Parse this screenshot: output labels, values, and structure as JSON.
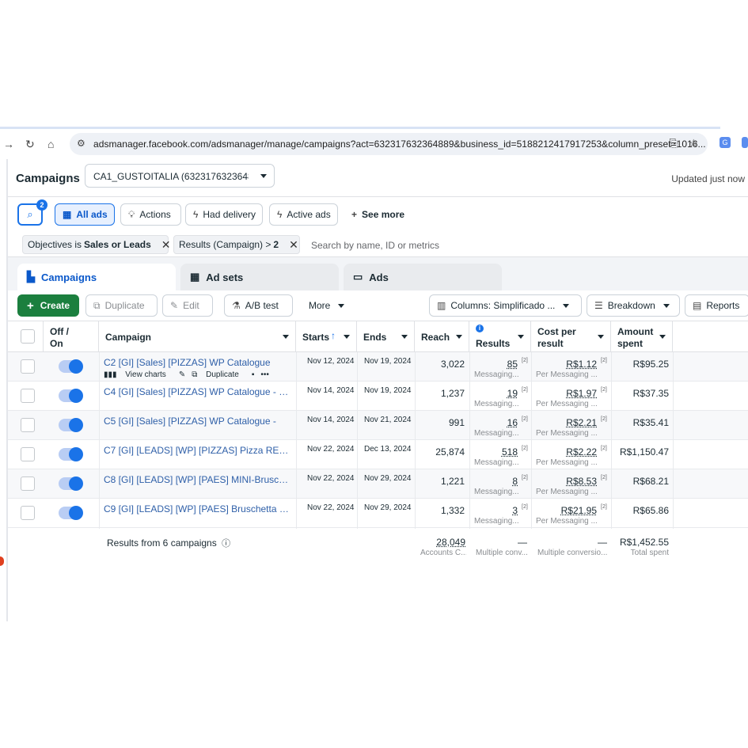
{
  "browser": {
    "url": "adsmanager.facebook.com/adsmanager/manage/campaigns?act=632317632364889&business_id=5188212417917253&column_preset=1016..."
  },
  "header": {
    "title": "Campaigns",
    "account": "CA1_GUSTOITALIA (63231763236488...",
    "updated": "Updated just now"
  },
  "filters": {
    "search_count": "2",
    "buttons": [
      "All ads",
      "Actions",
      "Had delivery",
      "Active ads",
      "See more"
    ],
    "chip1_prefix": "Objectives is",
    "chip1_value": "Sales or Leads",
    "chip2_prefix": "Results (Campaign) >",
    "chip2_value": "2",
    "search_placeholder": "Search by name, ID or metrics"
  },
  "tabs": [
    "Campaigns",
    "Ad sets",
    "Ads"
  ],
  "toolbar": {
    "create": "Create",
    "duplicate": "Duplicate",
    "edit": "Edit",
    "ab_test": "A/B test",
    "more": "More",
    "columns": "Columns: Simplificado ...",
    "breakdown": "Breakdown",
    "reports": "Reports"
  },
  "columns": {
    "off_on_1": "Off /",
    "off_on_2": "On",
    "campaign": "Campaign",
    "starts": "Starts",
    "ends": "Ends",
    "reach": "Reach",
    "results": "Results",
    "cost_1": "Cost per",
    "cost_2": "result",
    "amount_1": "Amount",
    "amount_2": "spent"
  },
  "row_actions": {
    "view_charts": "View charts",
    "duplicate": "Duplicate"
  },
  "rows": [
    {
      "name": "C2 [GI] [Sales] [PIZZAS] WP Catalogue",
      "starts": "Nov 12, 2024",
      "ends": "Nov 19, 2024",
      "reach": "3,022",
      "results": "85",
      "results_sub": "Messaging...",
      "cost": "R$1.12",
      "cost_sub": "Per Messaging ...",
      "spent": "R$95.25"
    },
    {
      "name": "C4 [GI] [Sales] [PIZZAS] WP Catalogue - [C2 C...",
      "starts": "Nov 14, 2024",
      "ends": "Nov 19, 2024",
      "reach": "1,237",
      "results": "19",
      "results_sub": "Messaging...",
      "cost": "R$1.97",
      "cost_sub": "Per Messaging ...",
      "spent": "R$37.35"
    },
    {
      "name": "C5 [GI] [Sales] [PIZZAS] WP Catalogue -",
      "starts": "Nov 14, 2024",
      "ends": "Nov 21, 2024",
      "reach": "991",
      "results": "16",
      "results_sub": "Messaging...",
      "cost": "R$2.21",
      "cost_sub": "Per Messaging ...",
      "spent": "R$35.41"
    },
    {
      "name": "C7 [GI] [LEADS] [WP] [PIZZAS] Pizza RETANG...",
      "starts": "Nov 22, 2024",
      "ends": "Dec 13, 2024",
      "reach": "25,874",
      "results": "518",
      "results_sub": "Messaging...",
      "cost": "R$2.22",
      "cost_sub": "Per Messaging ...",
      "spent": "R$1,150.47"
    },
    {
      "name": "C8 [GI] [LEADS] [WP] [PAES] MINI-Bruschetta ...",
      "starts": "Nov 22, 2024",
      "ends": "Nov 29, 2024",
      "reach": "1,221",
      "results": "8",
      "results_sub": "Messaging...",
      "cost": "R$8.53",
      "cost_sub": "Per Messaging ...",
      "spent": "R$68.21"
    },
    {
      "name": "C9 [GI] [LEADS] [WP] [PAES] Bruschetta Filone...",
      "starts": "Nov 22, 2024",
      "ends": "Nov 29, 2024",
      "reach": "1,332",
      "results": "3",
      "results_sub": "Messaging...",
      "cost": "R$21.95",
      "cost_sub": "Per Messaging ...",
      "spent": "R$65.86"
    }
  ],
  "totals": {
    "label": "Results from 6 campaigns",
    "reach": "28,049",
    "reach_sub": "Accounts C...",
    "results": "—",
    "results_sub": "Multiple conv...",
    "cost": "—",
    "cost_sub": "Multiple conversio...",
    "spent": "R$1,452.55",
    "spent_sub": "Total spent"
  },
  "colors": {
    "accent": "#1a73e8",
    "create_green": "#1b7f3e",
    "link_blue": "#2e5fa8"
  }
}
